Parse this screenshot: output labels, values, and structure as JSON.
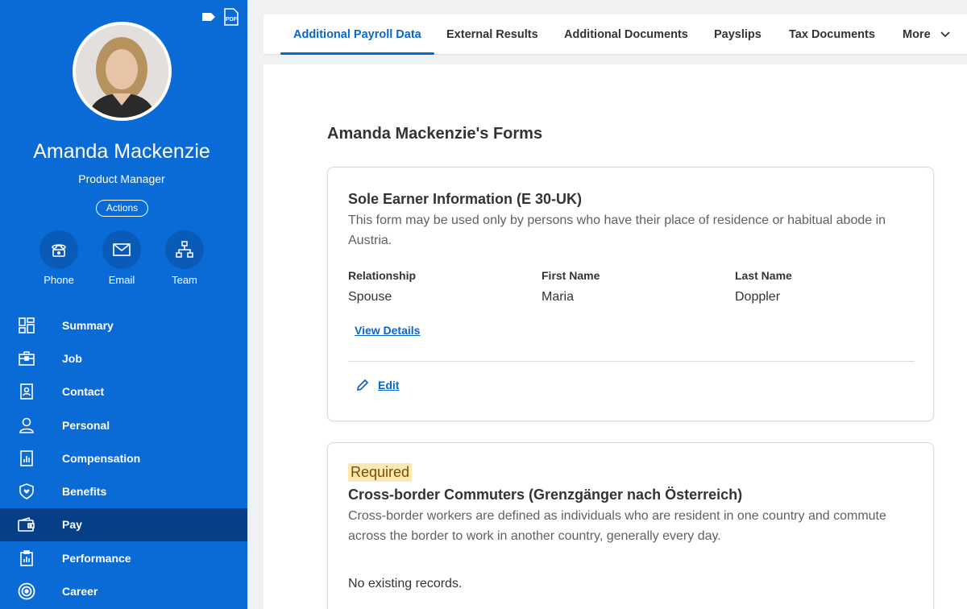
{
  "profile": {
    "name": "Amanda Mackenzie",
    "title": "Product Manager",
    "actions_label": "Actions",
    "pdf_label": "PDF"
  },
  "quick_actions": [
    {
      "label": "Phone",
      "icon": "phone-icon"
    },
    {
      "label": "Email",
      "icon": "email-icon"
    },
    {
      "label": "Team",
      "icon": "team-icon"
    }
  ],
  "nav": [
    {
      "label": "Summary",
      "icon": "summary-icon",
      "active": false
    },
    {
      "label": "Job",
      "icon": "job-icon",
      "active": false
    },
    {
      "label": "Contact",
      "icon": "contact-icon",
      "active": false
    },
    {
      "label": "Personal",
      "icon": "personal-icon",
      "active": false
    },
    {
      "label": "Compensation",
      "icon": "compensation-icon",
      "active": false
    },
    {
      "label": "Benefits",
      "icon": "benefits-icon",
      "active": false
    },
    {
      "label": "Pay",
      "icon": "pay-icon",
      "active": true
    },
    {
      "label": "Performance",
      "icon": "performance-icon",
      "active": false
    },
    {
      "label": "Career",
      "icon": "career-icon",
      "active": false
    }
  ],
  "tabs": [
    {
      "label": "Additional Payroll Data",
      "active": true
    },
    {
      "label": "External Results",
      "active": false
    },
    {
      "label": "Additional Documents",
      "active": false
    },
    {
      "label": "Payslips",
      "active": false
    },
    {
      "label": "Tax Documents",
      "active": false
    },
    {
      "label": "More",
      "active": false
    }
  ],
  "main": {
    "heading": "Amanda Mackenzie's Forms",
    "card1": {
      "title": "Sole Earner Information (E 30-UK)",
      "description": "This form may be used only by persons who have their place of residence or habitual abode in Austria.",
      "fields": [
        {
          "label": "Relationship",
          "value": "Spouse"
        },
        {
          "label": "First Name",
          "value": "Maria"
        },
        {
          "label": "Last Name",
          "value": "Doppler"
        }
      ],
      "view_details": "View Details",
      "edit": "Edit"
    },
    "card2": {
      "badge": "Required",
      "title": "Cross-border Commuters (Grenzgänger nach Österreich)",
      "description": "Cross-border workers are defined as individuals who are resident in one country and commute across the border to work in another country, generally every day.",
      "no_records": "No existing records."
    }
  },
  "colors": {
    "sidebar": "#0b6bd6",
    "sidebar_active": "#063f86",
    "accent": "#0a66c7",
    "badge_bg": "#fce8b2"
  }
}
